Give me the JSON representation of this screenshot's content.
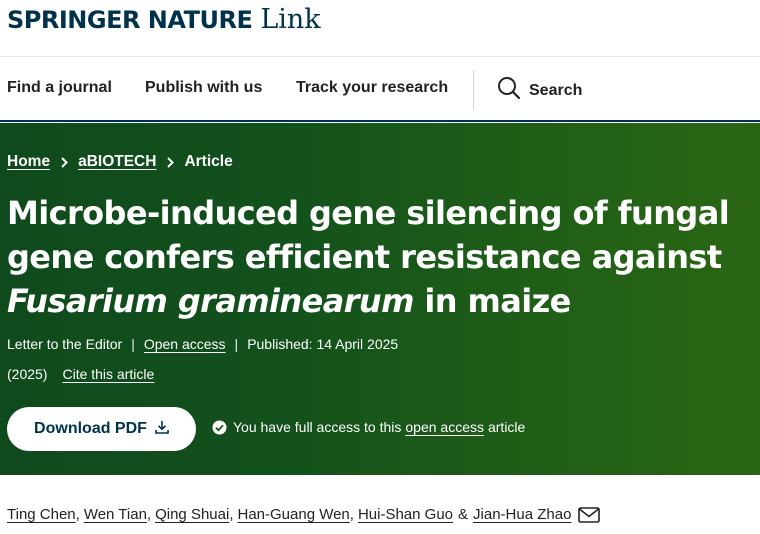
{
  "header": {
    "brand": "SPRINGER NATURE",
    "brand_suffix": "Link",
    "nav": [
      {
        "label": "Find a journal"
      },
      {
        "label": "Publish with us"
      },
      {
        "label": "Track your research"
      }
    ],
    "search_label": "Search"
  },
  "breadcrumb": [
    "Home",
    "aBIOTECH",
    "Article"
  ],
  "article": {
    "title_line1": "Microbe-induced gene silencing of fungal",
    "title_line2": "gene confers efficient resistance against",
    "title_line3_italic": "Fusarium graminearum",
    "title_line3_rest": " in maize",
    "article_type": "Letter to the Editor",
    "access_type": "Open access",
    "published": "Published: 14 April 2025",
    "year": "(2025)",
    "cite": "Cite this article",
    "download_label": "Download PDF",
    "access_prefix": "You have full access to this",
    "access_link": "open access",
    "access_suffix": "article"
  },
  "authors": {
    "names": [
      "Ting Chen",
      "Wen Tian",
      "Qing Shuai",
      "Han-Guang Wen",
      "Hui-Shan Guo",
      "Jian-Hua Zhao"
    ],
    "separator": ",",
    "last_separator": "&"
  },
  "icons": {
    "search": "search-icon",
    "chevron": "chevron-right-icon",
    "download": "download-icon",
    "check": "check-circle-icon",
    "mail": "envelope-icon"
  },
  "colors": {
    "brand": "#01324b",
    "hero_start": "#0f4a1c",
    "hero_end": "#2a6613"
  }
}
